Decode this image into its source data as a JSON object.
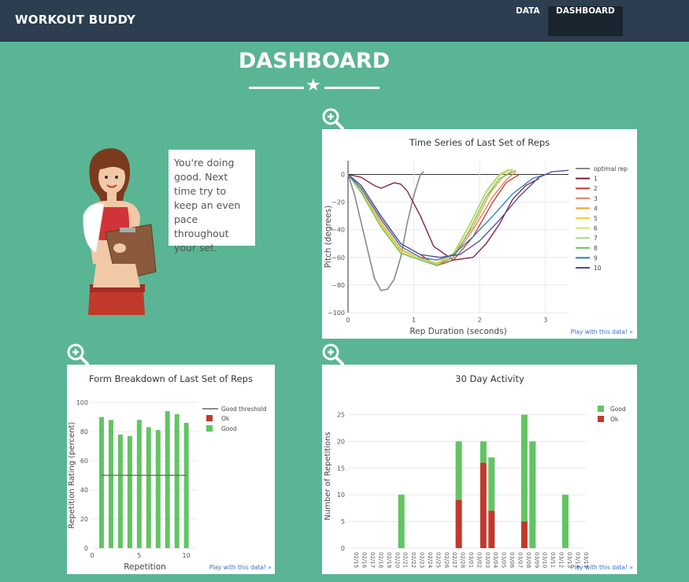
{
  "navbar": {
    "brand": "WORKOUT BUDDY",
    "links": [
      "DATA",
      "DASHBOARD"
    ]
  },
  "page": {
    "title": "DASHBOARD"
  },
  "coach": {
    "message": "You're doing good. Next time try to keep an even pace throughout your set."
  },
  "play_link": "Play with this data! »",
  "colors": {
    "background": "#5ab594",
    "navbar": "#2c3e50",
    "good": "#62c462",
    "ok": "#c0392b"
  },
  "chart_data": [
    {
      "type": "line",
      "title": "Time Series of Last Set of Reps",
      "xlabel": "Rep Duration (seconds)",
      "ylabel": "Pitch (degrees)",
      "xlim": [
        0,
        3.35
      ],
      "ylim": [
        -100,
        10
      ],
      "xticks": [
        "0",
        "1",
        "2",
        "3"
      ],
      "yticks": [
        "0",
        "−20",
        "−40",
        "−60",
        "−80",
        "−100"
      ],
      "legend_position": "right",
      "series": [
        {
          "name": "optimal rep",
          "color": "#888888",
          "x": [
            0,
            0.1,
            0.25,
            0.4,
            0.5,
            0.6,
            0.7,
            0.8,
            0.9,
            1.0,
            1.1,
            1.15
          ],
          "y": [
            0,
            -15,
            -45,
            -75,
            -84,
            -83,
            -76,
            -60,
            -35,
            -15,
            0,
            2
          ]
        },
        {
          "name": "1",
          "color": "#7b1a3a",
          "x": [
            0,
            0.2,
            0.4,
            0.5,
            0.6,
            0.7,
            0.8,
            0.9,
            1.1,
            1.3,
            1.6,
            1.9,
            2.1,
            2.3,
            2.5,
            2.7,
            2.9
          ],
          "y": [
            0,
            -2,
            -8,
            -10,
            -8,
            -6,
            -7,
            -12,
            -30,
            -52,
            -62,
            -60,
            -50,
            -36,
            -18,
            -8,
            -3
          ]
        },
        {
          "name": "2",
          "color": "#c0392b",
          "x": [
            0,
            0.2,
            0.5,
            0.8,
            1.1,
            1.35,
            1.6,
            1.9,
            2.2,
            2.4,
            2.6
          ],
          "y": [
            0,
            -8,
            -30,
            -50,
            -58,
            -66,
            -62,
            -45,
            -20,
            -6,
            0
          ]
        },
        {
          "name": "3",
          "color": "#e67e5a",
          "x": [
            0,
            0.2,
            0.5,
            0.8,
            1.1,
            1.35,
            1.6,
            1.9,
            2.2,
            2.4,
            2.55
          ],
          "y": [
            0,
            -10,
            -33,
            -52,
            -60,
            -65,
            -60,
            -40,
            -16,
            -4,
            2
          ]
        },
        {
          "name": "4",
          "color": "#f0a030",
          "x": [
            0,
            0.2,
            0.5,
            0.8,
            1.1,
            1.35,
            1.6,
            1.9,
            2.15,
            2.35,
            2.5
          ],
          "y": [
            0,
            -11,
            -35,
            -54,
            -61,
            -64,
            -58,
            -38,
            -14,
            -2,
            3
          ]
        },
        {
          "name": "5",
          "color": "#f0d040",
          "x": [
            0,
            0.2,
            0.5,
            0.8,
            1.1,
            1.35,
            1.6,
            1.85,
            2.1,
            2.3,
            2.45
          ],
          "y": [
            0,
            -12,
            -36,
            -55,
            -61,
            -64,
            -57,
            -36,
            -12,
            0,
            4
          ]
        },
        {
          "name": "6",
          "color": "#d8e06a",
          "x": [
            0,
            0.2,
            0.5,
            0.8,
            1.1,
            1.35,
            1.6,
            1.85,
            2.1,
            2.3,
            2.45
          ],
          "y": [
            0,
            -12,
            -37,
            -56,
            -62,
            -65,
            -58,
            -37,
            -13,
            -1,
            3
          ]
        },
        {
          "name": "7",
          "color": "#a8d888",
          "x": [
            0,
            0.2,
            0.5,
            0.8,
            1.1,
            1.35,
            1.6,
            1.85,
            2.1,
            2.3,
            2.5
          ],
          "y": [
            0,
            -13,
            -38,
            -57,
            -62,
            -65,
            -58,
            -36,
            -12,
            0,
            4
          ]
        },
        {
          "name": "8",
          "color": "#62c462",
          "x": [
            0,
            0.2,
            0.5,
            0.8,
            1.1,
            1.35,
            1.6,
            1.85,
            2.1,
            2.3,
            2.55
          ],
          "y": [
            0,
            -13,
            -38,
            -57,
            -62,
            -66,
            -60,
            -40,
            -16,
            -3,
            3
          ]
        },
        {
          "name": "9",
          "color": "#2a7fbf",
          "x": [
            0,
            0.2,
            0.5,
            0.8,
            1.1,
            1.35,
            1.6,
            1.9,
            2.2,
            2.5,
            2.8,
            3.0
          ],
          "y": [
            0,
            -10,
            -32,
            -52,
            -60,
            -62,
            -58,
            -45,
            -30,
            -14,
            -3,
            0
          ]
        },
        {
          "name": "10",
          "color": "#4a4aa0",
          "x": [
            0,
            0.2,
            0.5,
            0.8,
            1.1,
            1.4,
            1.7,
            2.0,
            2.3,
            2.6,
            2.9,
            3.1,
            3.35
          ],
          "y": [
            0,
            -8,
            -30,
            -50,
            -58,
            -60,
            -58,
            -48,
            -33,
            -16,
            -2,
            2,
            3
          ]
        }
      ]
    },
    {
      "type": "bar",
      "title": "Form Breakdown of Last Set of Reps",
      "xlabel": "Repetition",
      "ylabel": "Repetition Rating (percent)",
      "xlim": [
        0,
        11.2
      ],
      "ylim": [
        0,
        100
      ],
      "xticks": [
        "0",
        "5",
        "10"
      ],
      "yticks": [
        "0",
        "20",
        "40",
        "60",
        "80",
        "100"
      ],
      "legend_position": "right",
      "categories": [
        1,
        2,
        3,
        4,
        5,
        6,
        7,
        8,
        9,
        10
      ],
      "series": [
        {
          "name": "Good threshold",
          "type": "line",
          "color": "#666666",
          "y": 50
        },
        {
          "name": "Ok",
          "color": "#c0392b",
          "values": [
            0,
            0,
            0,
            0,
            0,
            0,
            0,
            0,
            0,
            0
          ]
        },
        {
          "name": "Good",
          "color": "#62c462",
          "values": [
            90,
            88,
            78,
            77,
            88,
            83,
            81,
            94,
            92,
            86
          ]
        }
      ]
    },
    {
      "type": "bar",
      "stacked": true,
      "title": "30 Day Activity",
      "xlabel": "",
      "ylabel": "Number of Repetitions",
      "ylim": [
        0,
        27
      ],
      "yticks": [
        "0",
        "5",
        "10",
        "15",
        "20",
        "25"
      ],
      "legend_position": "top-right",
      "categories": [
        "02/15",
        "02/16",
        "02/17",
        "02/18",
        "02/19",
        "02/20",
        "02/21",
        "02/22",
        "02/23",
        "02/24",
        "02/25",
        "02/26",
        "02/27",
        "02/28",
        "03/01",
        "03/02",
        "03/03",
        "03/04",
        "03/05",
        "03/06",
        "03/07",
        "03/08",
        "03/09",
        "03/10",
        "03/11",
        "03/12",
        "03/13",
        "03/14",
        "03/15"
      ],
      "series": [
        {
          "name": "Good",
          "color": "#62c462",
          "values": [
            0,
            0,
            0,
            0,
            0,
            0,
            10,
            0,
            0,
            0,
            0,
            0,
            0,
            11,
            0,
            0,
            4,
            10,
            0,
            0,
            0,
            20,
            20,
            0,
            0,
            0,
            10,
            0,
            0
          ]
        },
        {
          "name": "Ok",
          "color": "#c0392b",
          "values": [
            0,
            0,
            0,
            0,
            0,
            0,
            0,
            0,
            0,
            0,
            0,
            0,
            0,
            9,
            0,
            0,
            16,
            7,
            0,
            0,
            0,
            5,
            0,
            0,
            0,
            0,
            0,
            0,
            0
          ]
        }
      ]
    }
  ]
}
